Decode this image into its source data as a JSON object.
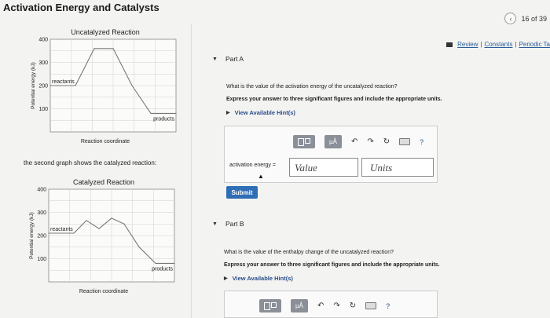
{
  "page": {
    "title": "Activation Energy and Catalysts",
    "pager_text": "16 of 39",
    "links": [
      "Review",
      "Constants",
      "Periodic Ta"
    ]
  },
  "chart_data": [
    {
      "type": "line",
      "title": "Uncatalyzed Reaction",
      "xlabel": "Reaction coordinate",
      "ylabel": "Potential energy (kJ)",
      "yticks": [
        "400",
        "300",
        "200",
        "100"
      ],
      "ylim": [
        0,
        400
      ],
      "x": [
        0,
        0.2,
        0.35,
        0.5,
        0.65,
        0.8,
        1.0
      ],
      "y": [
        200,
        200,
        360,
        360,
        200,
        80,
        80
      ],
      "annotations": [
        "reactants",
        "products"
      ],
      "grid": true
    },
    {
      "type": "line",
      "title": "Catalyzed Reaction",
      "xlabel": "Reaction coordinate",
      "ylabel": "Potential energy (kJ)",
      "yticks": [
        "400",
        "300",
        "200",
        "100"
      ],
      "ylim": [
        0,
        400
      ],
      "x": [
        0,
        0.2,
        0.3,
        0.4,
        0.5,
        0.6,
        0.72,
        0.85,
        1.0
      ],
      "y": [
        210,
        210,
        265,
        230,
        275,
        250,
        150,
        80,
        80
      ],
      "annotations": [
        "reactants",
        "products"
      ],
      "grid": true
    }
  ],
  "left": {
    "mid_text": "the second graph shows the catalyzed reaction:"
  },
  "partA": {
    "label": "Part A",
    "question": "What is the value of the activation energy of the uncatalyzed reaction?",
    "instruction": "Express your answer to three significant figures and include the appropriate units.",
    "hint": "View Available Hint(s)",
    "eq_label": "activation energy =",
    "value_placeholder": "Value",
    "units_placeholder": "Units",
    "submit": "Submit",
    "mu_label": "µÅ",
    "help_label": "?"
  },
  "partB": {
    "label": "Part B",
    "question": "What is the value of the enthalpy change of the uncatalyzed reaction?",
    "instruction": "Express your answer to three significant figures and include the appropriate units.",
    "hint": "View Available Hint(s)",
    "mu_label": "µÅ",
    "help_label": "?"
  }
}
